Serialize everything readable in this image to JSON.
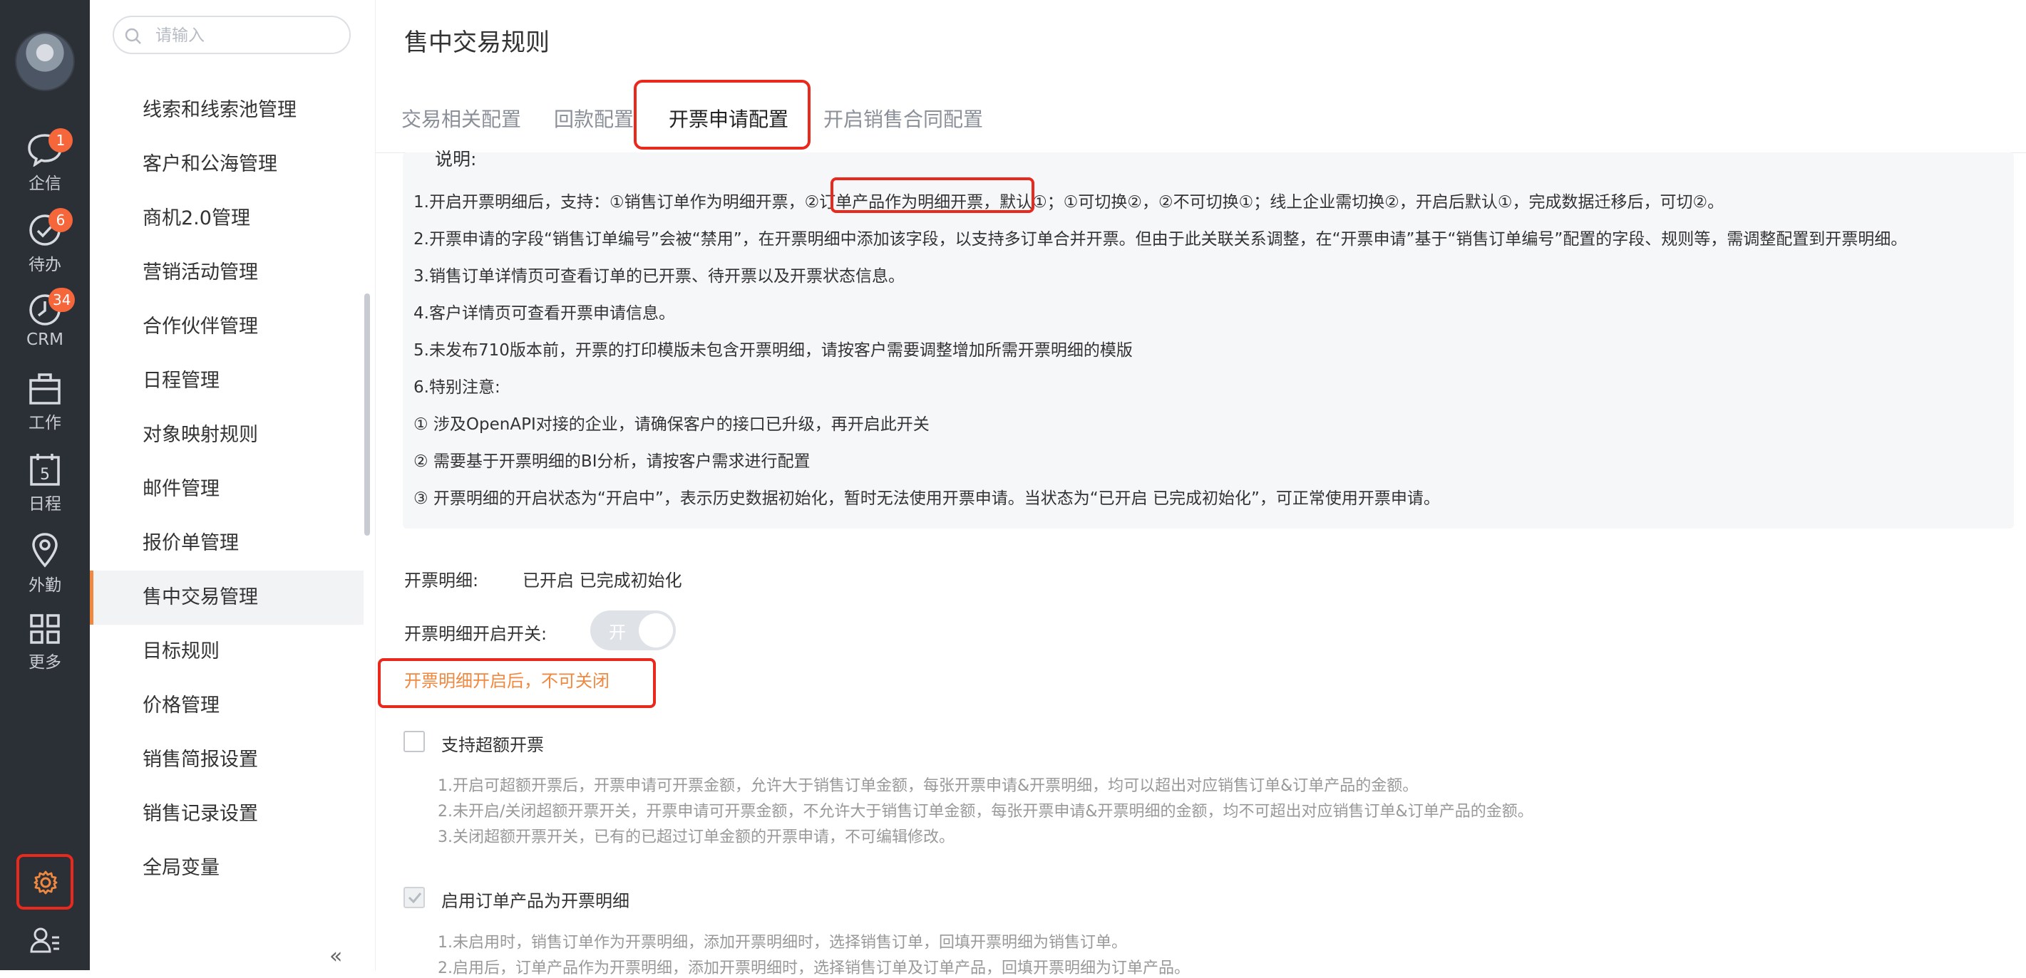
{
  "rail": {
    "items": [
      {
        "label": "企信",
        "badge": "1",
        "icon": "chat-icon"
      },
      {
        "label": "待办",
        "badge": "6",
        "icon": "check-circle-icon"
      },
      {
        "label": "CRM",
        "badge": "34",
        "icon": "clock-icon"
      },
      {
        "label": "工作",
        "badge": "",
        "icon": "briefcase-icon"
      },
      {
        "label": "日程",
        "badge": "",
        "icon": "calendar-icon",
        "day": "5"
      },
      {
        "label": "外勤",
        "badge": "",
        "icon": "location-pin-icon"
      },
      {
        "label": "更多",
        "badge": "",
        "icon": "grid-icon"
      }
    ],
    "accent": "#f0883f"
  },
  "search": {
    "placeholder": "请输入"
  },
  "nav": {
    "items": [
      "线索和线索池管理",
      "客户和公海管理",
      "商机2.0管理",
      "营销活动管理",
      "合作伙伴管理",
      "日程管理",
      "对象映射规则",
      "邮件管理",
      "报价单管理",
      "售中交易管理",
      "目标规则",
      "价格管理",
      "销售简报设置",
      "销售记录设置",
      "全局变量"
    ],
    "active_index": 9,
    "collapse_label": "«"
  },
  "page": {
    "title": "售中交易规则"
  },
  "tabs": [
    {
      "label": "交易相关配置"
    },
    {
      "label": "回款配置"
    },
    {
      "label": "开票申请配置"
    },
    {
      "label": "开启销售合同配置"
    }
  ],
  "description": {
    "title": "说明:",
    "lines": [
      "1.开启开票明细后，支持：①销售订单作为明细开票，②订单产品作为明细开票，默认①；①可切换②，②不可切换①；线上企业需切换②，开启后默认①，完成数据迁移后，可切②。",
      "2.开票申请的字段“销售订单编号”会被“禁用”，在开票明细中添加该字段，以支持多订单合并开票。但由于此关联关系调整，在“开票申请”基于“销售订单编号”配置的字段、规则等，需调整配置到开票明细。",
      "3.销售订单详情页可查看订单的已开票、待开票以及开票状态信息。",
      "4.客户详情页可查看开票申请信息。",
      "5.未发布710版本前，开票的打印模版未包含开票明细，请按客户需要调整增加所需开票明细的模版",
      "6.特别注意:",
      "① 涉及OpenAPI对接的企业，请确保客户的接口已升级，再开启此开关",
      "② 需要基于开票明细的BI分析，请按客户需求进行配置",
      "③ 开票明细的开启状态为“开启中”，表示历史数据初始化，暂时无法使用开票申请。当状态为“已开启 已完成初始化”，可正常使用开票申请。"
    ]
  },
  "invoice_detail": {
    "label": "开票明细:",
    "status": "已开启 已完成初始化"
  },
  "switch": {
    "label": "开票明细开启开关:",
    "state_text": "开",
    "warning": "开票明细开启后，不可关闭"
  },
  "over_invoice": {
    "label": "支持超额开票",
    "checked": false,
    "notes": [
      "1.开启可超额开票后，开票申请可开票金额，允许大于销售订单金额，每张开票申请&开票明细，均可以超出对应销售订单&订单产品的金额。",
      "2.未开启/关闭超额开票开关，开票申请可开票金额，不允许大于销售订单金额，每张开票申请&开票明细的金额，均不可超出对应销售订单&订单产品的金额。",
      "3.关闭超额开票开关，已有的已超过订单金额的开票申请，不可编辑修改。"
    ]
  },
  "order_product": {
    "label": "启用订单产品为开票明细",
    "checked": true,
    "notes": [
      "1.未启用时，销售订单作为开票明细，添加开票明细时，选择销售订单，回填开票明细为销售订单。",
      "2.启用后，订单产品作为开票明细，添加开票明细时，选择销售订单及订单产品，回填开票明细为订单产品。"
    ]
  }
}
